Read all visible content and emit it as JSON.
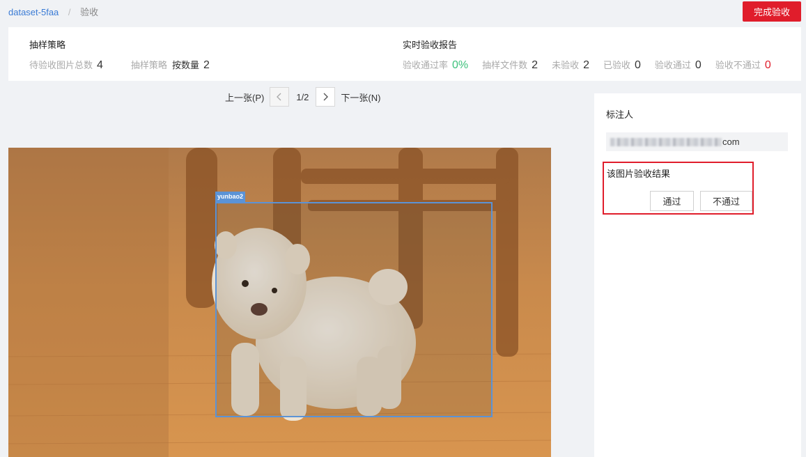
{
  "breadcrumb": {
    "dataset": "dataset-5faa",
    "separator": "/",
    "current": "验收"
  },
  "header": {
    "finish_label": "完成验收"
  },
  "sampling": {
    "title": "抽样策略",
    "pending_label": "待验收图片总数",
    "pending_value": "4",
    "strategy_label": "抽样策略",
    "strategy_mode": "按数量",
    "strategy_value": "2"
  },
  "report": {
    "title": "实时验收报告",
    "pass_rate_label": "验收通过率",
    "pass_rate_value": "0%",
    "sample_files_label": "抽样文件数",
    "sample_files_value": "2",
    "unchecked_label": "未验收",
    "unchecked_value": "2",
    "checked_label": "已验收",
    "checked_value": "0",
    "passed_label": "验收通过",
    "passed_value": "0",
    "failed_label": "验收不通过",
    "failed_value": "0",
    "colors": {
      "pass_rate": "#3cc17b",
      "failed": "#e01d2b"
    }
  },
  "pager": {
    "prev_label": "上一张(P)",
    "next_label": "下一张(N)",
    "count": "1/2",
    "prev_icon": "chevron-left-icon",
    "next_icon": "chevron-right-icon"
  },
  "annotation": {
    "label": "yunbao2"
  },
  "side": {
    "labeler_title": "标注人",
    "labeler_suffix": "com",
    "result_title": "该图片验收结果",
    "pass_label": "通过",
    "fail_label": "不通过"
  },
  "colors": {
    "accent": "#e01d2b",
    "link": "#3a7bd5",
    "bbox": "#5b93d6"
  }
}
